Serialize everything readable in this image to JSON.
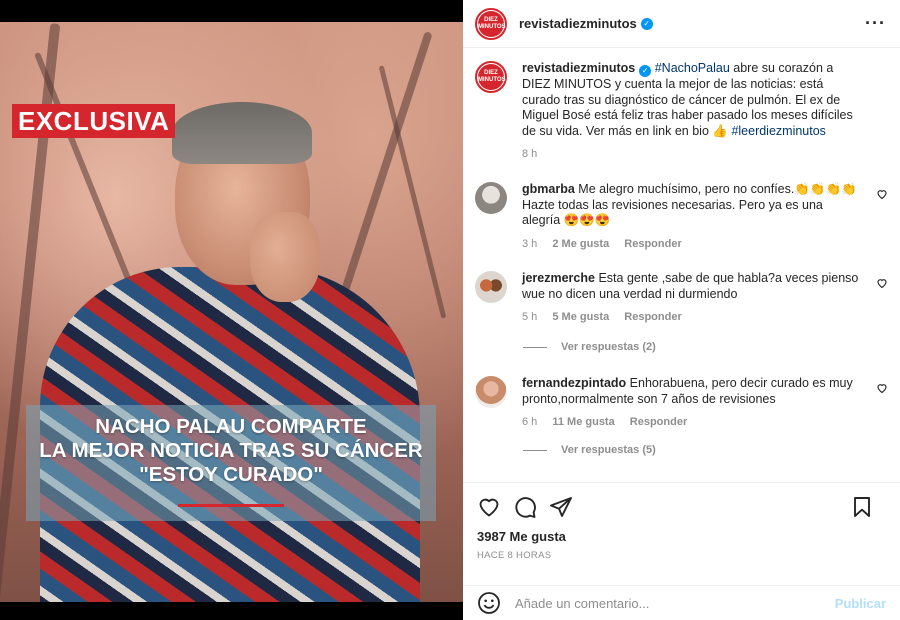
{
  "post": {
    "badge": "EXCLUSIVA",
    "headline": [
      "NACHO PALAU COMPARTE",
      "LA MEJOR NOTICIA TRAS SU CÁNCER",
      "\"ESTOY CURADO\""
    ]
  },
  "header": {
    "username": "revistadiezminutos",
    "avatar_text_1": "DIEZ",
    "avatar_text_2": "MINUTOS"
  },
  "caption": {
    "username": "revistadiezminutos",
    "hashtag": "#NachoPalau",
    "text": " abre su corazón a DIEZ MINUTOS y cuenta la mejor de las noticias: está curado tras su diagnóstico de cáncer de pulmón. El ex de Miguel Bosé está feliz tras haber pasado los meses difíciles de su vida. Ver más en link en bio 👍 ",
    "hashtag2": "#leerdiezminutos",
    "time": "8 h"
  },
  "comments": [
    {
      "username": "gbmarba",
      "text": "Me alegro muchísimo, pero no confíes.👏👏👏👏 Hazte todas las revisiones necesarias. Pero ya es una alegría 😍😍😍",
      "time": "3 h",
      "likes": "2 Me gusta",
      "reply": "Responder"
    },
    {
      "username": "jerezmerche",
      "text": "Esta gente ,sabe de que habla?a veces pienso wue no dicen una verdad ni durmiendo",
      "time": "5 h",
      "likes": "5 Me gusta",
      "reply": "Responder",
      "view_replies": "Ver respuestas (2)"
    },
    {
      "username": "fernandezpintado",
      "text": "Enhorabuena, pero decir curado es muy pronto,normalmente son 7 años de revisiones",
      "time": "6 h",
      "likes": "11 Me gusta",
      "reply": "Responder",
      "view_replies": "Ver respuestas (5)"
    }
  ],
  "stats": {
    "likes": "3987 Me gusta",
    "posted": "HACE 8 HORAS"
  },
  "composer": {
    "placeholder": "Añade un comentario...",
    "publish": "Publicar"
  },
  "icons": {
    "like": "heart-icon",
    "comment": "comment-icon",
    "share": "share-icon",
    "save": "bookmark-icon",
    "emoji": "emoji-icon",
    "more": "more-options-icon"
  }
}
